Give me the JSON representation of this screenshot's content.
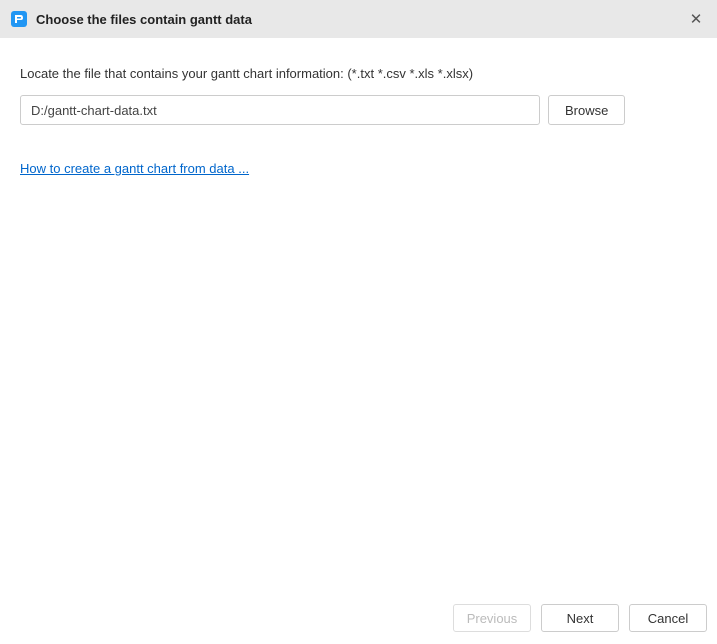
{
  "header": {
    "title": "Choose the files contain gantt data"
  },
  "content": {
    "instruction": "Locate the file that contains your gantt chart information: (*.txt *.csv *.xls *.xlsx)",
    "filePath": "D:/gantt-chart-data.txt",
    "browseLabel": "Browse",
    "helpLinkText": "How to create a gantt chart from data ..."
  },
  "footer": {
    "previousLabel": "Previous",
    "nextLabel": "Next",
    "cancelLabel": "Cancel"
  }
}
